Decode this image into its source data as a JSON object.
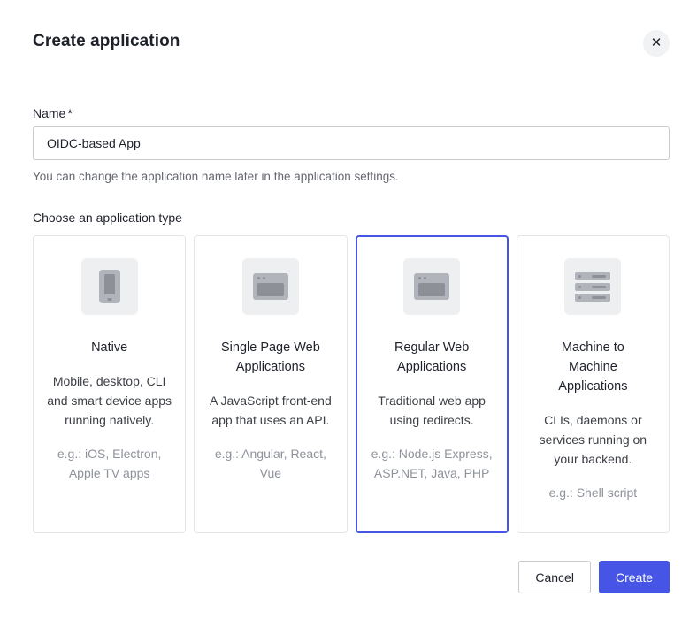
{
  "modal": {
    "title": "Create application",
    "close_icon": "✕"
  },
  "name_field": {
    "label": "Name",
    "required_marker": "*",
    "value": "OIDC-based App",
    "helper": "You can change the application name later in the application settings."
  },
  "type_section": {
    "label": "Choose an application type",
    "cards": [
      {
        "icon": "phone-icon",
        "title": "Native",
        "description": "Mobile, desktop, CLI and smart device apps running natively.",
        "examples": "e.g.: iOS, Electron, Apple TV apps",
        "selected": false
      },
      {
        "icon": "browser-icon",
        "title": "Single Page Web Applications",
        "description": "A JavaScript front-end app that uses an API.",
        "examples": "e.g.: Angular, React, Vue",
        "selected": false
      },
      {
        "icon": "browser-icon",
        "title": "Regular Web Applications",
        "description": "Traditional web app using redirects.",
        "examples": "e.g.: Node.js Express, ASP.NET, Java, PHP",
        "selected": true
      },
      {
        "icon": "server-icon",
        "title": "Machine to Machine Applications",
        "description": "CLIs, daemons or services running on your backend.",
        "examples": "e.g.: Shell script",
        "selected": false
      }
    ]
  },
  "footer": {
    "cancel_label": "Cancel",
    "create_label": "Create"
  },
  "colors": {
    "accent": "#4655e6",
    "selected_border": "#4655e6"
  }
}
